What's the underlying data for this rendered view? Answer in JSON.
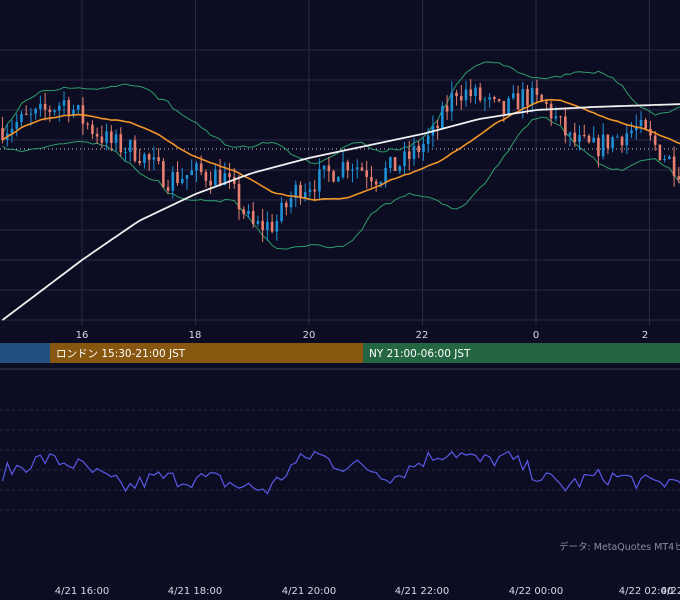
{
  "colors": {
    "background": "#0c0c22",
    "grid": "#2a2a48",
    "candle_up": "#1e90d6",
    "candle_down": "#e8806f",
    "bollinger": "#2e9e6a",
    "ma_short": "#f0952a",
    "ma_long": "#f0f0f0",
    "price_line": "#c8c8c8",
    "oscillator": "#5a5ae8",
    "session_tokyo": "#22507e",
    "session_london": "#87560f",
    "session_ny": "#246642"
  },
  "sessions": {
    "london_label": "ロンドン 15:30-21:00 JST",
    "ny_label": "NY 21:00-06:00 JST"
  },
  "main_axis": {
    "tick_labels": [
      "16",
      "18",
      "20",
      "22",
      "0",
      "2"
    ]
  },
  "bottom_axis": {
    "tick_labels": [
      "4/21 16:00",
      "4/21 18:00",
      "4/21 20:00",
      "4/21 22:00",
      "4/22 00:00",
      "4/22 02:00",
      "4/22"
    ]
  },
  "credit": "データ: MetaQuotes MT4ヒ",
  "chart_data": [
    {
      "type": "candlestick",
      "x_unit": "hours (JST)",
      "x_ticks": [
        16,
        18,
        20,
        22,
        24,
        26
      ],
      "x_tick_labels": [
        "16",
        "18",
        "20",
        "22",
        "0",
        "2"
      ],
      "x_range": [
        14.6,
        26.6
      ],
      "y_range": [
        0,
        100
      ],
      "anchor_closes": [
        [
          14.6,
          64
        ],
        [
          15.2,
          68
        ],
        [
          15.7,
          73
        ],
        [
          16.1,
          65
        ],
        [
          16.5,
          59
        ],
        [
          17.0,
          56
        ],
        [
          17.5,
          47
        ],
        [
          18.0,
          49
        ],
        [
          18.5,
          48
        ],
        [
          19.0,
          31
        ],
        [
          19.4,
          32
        ],
        [
          19.8,
          44
        ],
        [
          20.2,
          47
        ],
        [
          20.7,
          53
        ],
        [
          21.2,
          48
        ],
        [
          21.7,
          53
        ],
        [
          22.2,
          62
        ],
        [
          22.6,
          77
        ],
        [
          23.0,
          74
        ],
        [
          23.4,
          69
        ],
        [
          23.8,
          75
        ],
        [
          24.2,
          71
        ],
        [
          24.6,
          60
        ],
        [
          25.0,
          57
        ],
        [
          25.4,
          61
        ],
        [
          25.8,
          64
        ],
        [
          26.2,
          56
        ],
        [
          26.6,
          49
        ]
      ],
      "bars_per_hour": 12,
      "indicators": [
        "bollinger_bands",
        "moving_average_short",
        "moving_average_long"
      ],
      "reference_level": 57
    },
    {
      "type": "line",
      "name": "",
      "x_range": [
        14.6,
        26.6
      ],
      "y_range": [
        0,
        100
      ],
      "anchor_values": [
        [
          14.6,
          48
        ],
        [
          15.3,
          58
        ],
        [
          15.9,
          54
        ],
        [
          16.3,
          46
        ],
        [
          16.8,
          37
        ],
        [
          17.3,
          45
        ],
        [
          17.8,
          43
        ],
        [
          18.3,
          44
        ],
        [
          18.8,
          38
        ],
        [
          19.3,
          36
        ],
        [
          19.7,
          53
        ],
        [
          20.1,
          62
        ],
        [
          20.5,
          54
        ],
        [
          21.0,
          52
        ],
        [
          21.5,
          45
        ],
        [
          22.0,
          57
        ],
        [
          22.5,
          64
        ],
        [
          23.0,
          56
        ],
        [
          23.5,
          59
        ],
        [
          24.0,
          47
        ],
        [
          24.5,
          38
        ],
        [
          25.0,
          45
        ],
        [
          25.5,
          45
        ],
        [
          26.0,
          40
        ],
        [
          26.6,
          43
        ]
      ]
    }
  ]
}
